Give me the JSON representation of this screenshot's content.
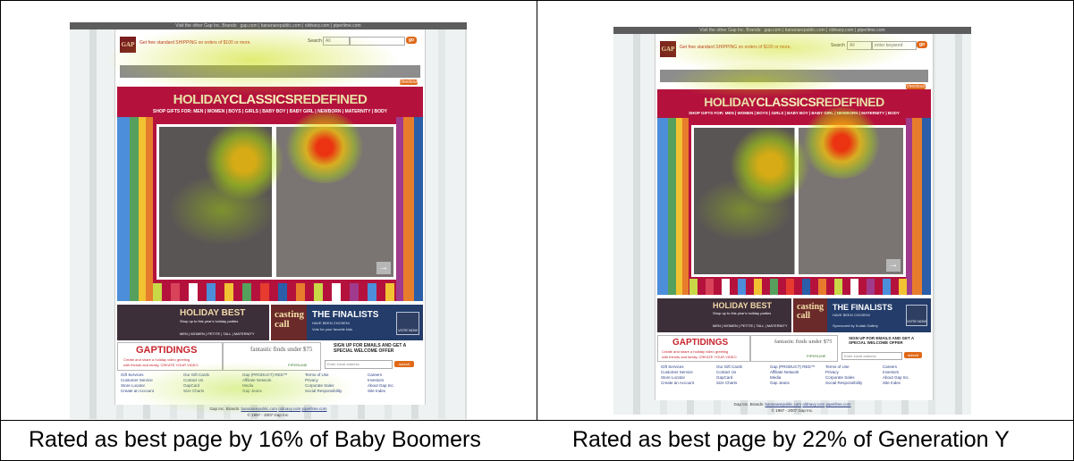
{
  "captions": {
    "left": "Rated as best page by 16% of Baby Boomers",
    "right": "Rated as best page by 22% of Generation Y"
  },
  "site": {
    "topbar_prefix": "Visit the other Gap Inc. Brands:",
    "topbar_links": [
      "gap.com",
      "bananarepublic.com",
      "oldnavy.com",
      "piperlime.com"
    ],
    "logo": "GAP",
    "promo": "Get free standard SHIPPING on orders of $100 or more.",
    "promo_details": "details",
    "search_label": "Search",
    "search_scope": "All",
    "search_placeholder": "enter keyword",
    "go_label": "go",
    "checkout_label": "checkout",
    "hero_title_1": "HOLIDAY",
    "hero_title_2": "CLASSICS",
    "hero_title_3": "REDEFINED",
    "hero_sub": "SHOP GIFTS FOR: MEN | WOMEN | BOYS | GIRLS | BABY BOY | BABY GIRL | NEWBORN | MATERNITY | BODY",
    "ad_holiday_title": "HOLIDAY BEST",
    "ad_holiday_sub1": "Shop up to this year's holiday parties",
    "ad_holiday_sub2": "in the best styles of the season.",
    "ad_holiday_sub3": "SHOP DRESSY LOOKS FOR:",
    "ad_holiday_links": "MEN | WOMEN | PETITE | TALL | MATERNITY",
    "ad_casting": "casting call",
    "ad_finalists_title": "THE FINALISTS",
    "ad_finalists_sub": "HAVE BEEN CHOSEN!",
    "ad_finalists_vote": "Vote for your favorite kids",
    "ad_finalists_vote2": "and babies today.",
    "ad_finalists_sponsor": "Sponsored by Kodak Gallery",
    "vote_label": "VOTE NOW",
    "gaptidings_title": "GAPTIDINGS",
    "gaptidings_sub1": "Create and share a holiday video greeting",
    "gaptidings_sub2": "with friends and family. CREATE YOUR VIDEO",
    "finds_title": "fantastic finds under $75",
    "finds_sub": "More fabulous & fun! Shop now",
    "piperlime": "PIPERLIME",
    "signup_text": "SIGN UP FOR EMAILS AND GET A SPECIAL WELCOME OFFER",
    "signup_placeholder": "Enter email address",
    "submit_label": "submit",
    "footer_cols": [
      [
        "Gift Services",
        "Customer Service",
        "Store Locator",
        "Create an Account"
      ],
      [
        "Our Gift Cards",
        "Contact Us",
        "GapCard",
        "Size Charts"
      ],
      [
        "Gap (PRODUCT) RED™",
        "Affiliate Network",
        "Media",
        "Gap Jeans"
      ],
      [
        "Terms of Use",
        "Privacy",
        "Corporate Sales",
        "Social Responsibility"
      ],
      [
        "Careers",
        "Investors",
        "About Gap Inc.",
        "Site Index"
      ]
    ],
    "footer_brands_prefix": "Gap Inc. Brands:",
    "footer_brands": [
      "bananarepublic.com",
      "oldnavy.com",
      "piperlime.com"
    ],
    "copyright": "© 1997 - 2007 Gap Inc."
  },
  "colors": {
    "hero": "#b4123d",
    "stripes": [
      "#e63b2e",
      "#4c8ed9",
      "#f1c232",
      "#55a05c",
      "#e77c2d",
      "#a03a8c",
      "#ffffff",
      "#2a5ea8",
      "#c8d847",
      "#d9435a"
    ]
  }
}
